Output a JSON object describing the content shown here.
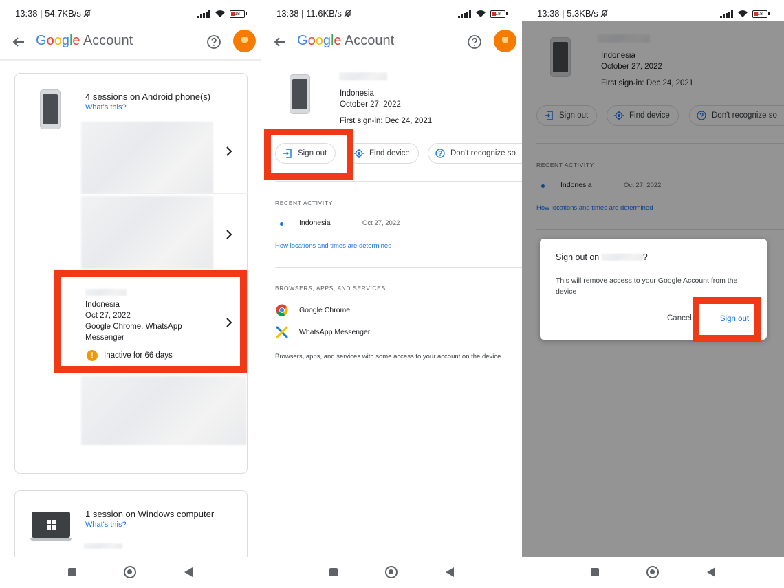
{
  "colors": {
    "highlight": "#f03a17",
    "link": "#1a73e8",
    "avatar": "#f57c00",
    "warning": "#f29900"
  },
  "panel1": {
    "status": {
      "time": "13:38 | 54.7KB/s",
      "battery": "18"
    },
    "header": {
      "brand": [
        "G",
        "o",
        "o",
        "g",
        "l",
        "e"
      ],
      "title_suffix": " Account"
    },
    "android_card": {
      "heading": "4 sessions on Android phone(s)",
      "whats_this": "What's this?",
      "highlighted_session": {
        "location": "Indonesia",
        "date": "Oct 27, 2022",
        "apps_line1": "Google Chrome, WhatsApp",
        "apps_line2": "Messenger",
        "warning": "Inactive for 66 days"
      }
    },
    "windows_card": {
      "heading": "1 session on Windows computer",
      "whats_this": "What's this?"
    }
  },
  "panel2": {
    "status": {
      "time": "13:38 | 11.6KB/s",
      "battery": "18"
    },
    "header": {
      "title_suffix": " Account"
    },
    "device": {
      "location": "Indonesia",
      "date": "October 27, 2022",
      "first_signin": "First sign-in: Dec 24, 2021"
    },
    "actions": {
      "sign_out": "Sign out",
      "find_device": "Find device",
      "dont_recognize": "Don't recognize so"
    },
    "recent_activity": {
      "heading": "RECENT ACTIVITY",
      "location": "Indonesia",
      "date": "Oct 27, 2022",
      "link": "How locations and times are determined"
    },
    "apps": {
      "heading": "BROWSERS, APPS, AND SERVICES",
      "items": [
        "Google Chrome",
        "WhatsApp Messenger"
      ],
      "footnote": "Browsers, apps, and services with some access to your account on the device"
    }
  },
  "panel3": {
    "status": {
      "time": "13:38 | 5.3KB/s",
      "battery": "18"
    },
    "device": {
      "location": "Indonesia",
      "date": "October 27, 2022",
      "first_signin": "First sign-in: Dec 24, 2021"
    },
    "actions": {
      "sign_out": "Sign out",
      "find_device": "Find device",
      "dont_recognize": "Don't recognize so"
    },
    "recent_activity": {
      "heading": "RECENT ACTIVITY",
      "location": "Indonesia",
      "date": "Oct 27, 2022",
      "link": "How locations and times are determined"
    },
    "dialog": {
      "title_prefix": "Sign out on ",
      "title_suffix": "?",
      "body": "This will remove access to your Google Account from the device",
      "cancel": "Cancel",
      "confirm": "Sign out"
    }
  }
}
